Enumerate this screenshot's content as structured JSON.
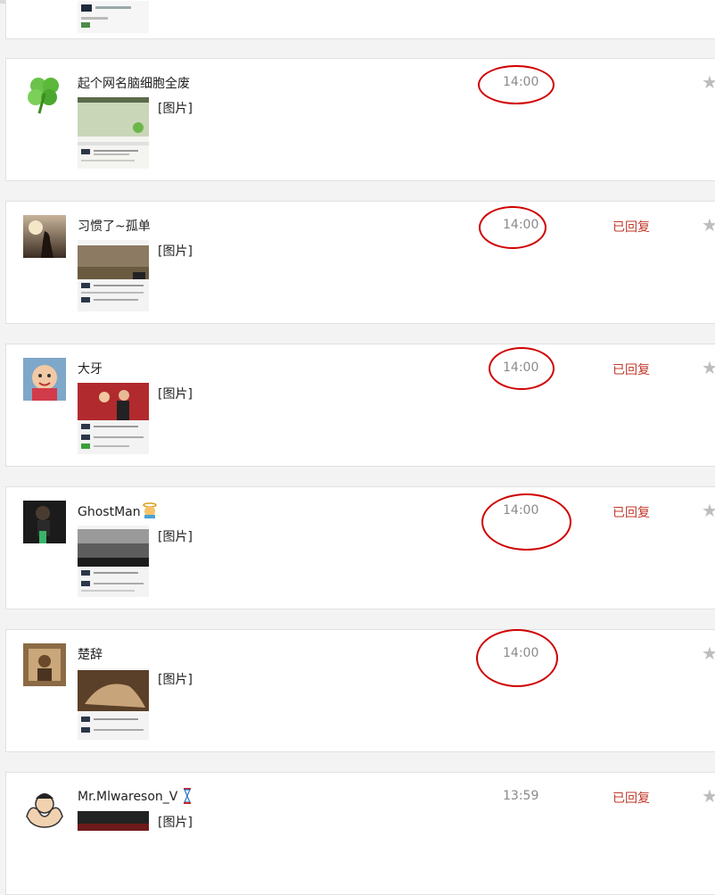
{
  "messages": [
    {
      "name": "",
      "image_label": "",
      "time": "",
      "replied": "",
      "avatar": "none"
    },
    {
      "name": "起个网名脑细胞全废",
      "image_label": "[图片]",
      "time": "14:00",
      "replied": "",
      "avatar": "clover-icon"
    },
    {
      "name": "习惯了~孤单",
      "image_label": "[图片]",
      "time": "14:00",
      "replied": "已回复",
      "avatar": "sunset-photo"
    },
    {
      "name": "大牙",
      "image_label": "[图片]",
      "time": "14:00",
      "replied": "已回复",
      "avatar": "baby-photo"
    },
    {
      "name": "GhostMan",
      "image_label": "[图片]",
      "time": "14:00",
      "replied": "已回复",
      "avatar": "ghost-photo"
    },
    {
      "name": "楚辞",
      "image_label": "[图片]",
      "time": "14:00",
      "replied": "",
      "avatar": "vintage-photo"
    },
    {
      "name": "Mr.Mlwareson_V",
      "image_label": "[图片]",
      "time": "13:59",
      "replied": "已回复",
      "avatar": "cartoon-strongman"
    }
  ],
  "icons": {
    "star": "★"
  },
  "colors": {
    "highlight_circle": "#d00000",
    "replied": "#c0392b",
    "time": "#8a8a8a"
  }
}
